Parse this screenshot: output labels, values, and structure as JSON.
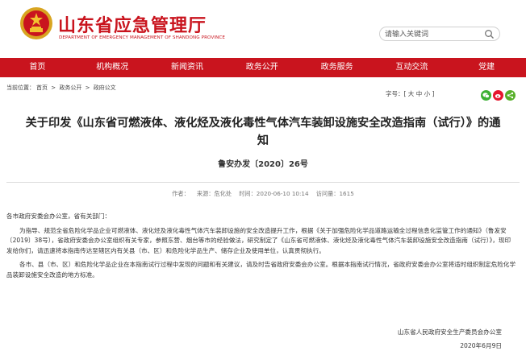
{
  "header": {
    "site_title": "山东省应急管理厅",
    "site_subtitle": "DEPARTMENT OF EMERGENCY MANAGEMENT OF SHANDONG PROVINCE",
    "search_placeholder": "请输入关键词"
  },
  "nav": {
    "items": [
      "首页",
      "机构概况",
      "新闻资讯",
      "政务公开",
      "政务服务",
      "互动交流",
      "党建"
    ]
  },
  "breadcrumb": {
    "prefix": "当前位置：",
    "items": [
      "首页",
      "政务公开",
      "政府公文"
    ],
    "separator": ">"
  },
  "font_size": {
    "label": "字号：",
    "options": "[ 大 中 小 ]"
  },
  "article": {
    "title": "关于印发《山东省可燃液体、液化烃及液化毒性气体汽车装卸设施安全改造指南（试行）》的通知",
    "doc_number": "鲁安办发〔2020〕26号",
    "author_label": "作者：",
    "author": "",
    "source_label": "来源：",
    "source": "危化处",
    "time_label": "时间：",
    "time": "2020-06-10 10:14",
    "views_label": "访问量：",
    "views": "1615",
    "salutation": "各市政府安委会办公室，省有关部门：",
    "paragraph1": "为指导、规范全省危险化学品企业可燃液体、液化烃及液化毒性气体汽车装卸设施的安全改造提升工作，根据《关于加强危险化学品道路运输全过程信息化监管工作的通知》（鲁发安〔2019〕38号），省政府安委会办公室组织有关专家，参照东营、烟台等市的经验做法，研究制定了《山东省可燃液体、液化烃及液化毒性气体汽车装卸设施安全改造指南（试行）》，现印发给你们，请迅速将本指南传达至辖区内有关县（市、区）和危险化学品生产、储存企业及使用单位，认真贯彻执行。",
    "paragraph2": "各市、县（市、区）和危险化学品企业在本指南试行过程中发现的问题和有关建议，请及时告省政府安委会办公室。根据本指南试行情况，省政府安委会办公室将适时组织制定危险化学品装卸设施安全改造的地方标准。",
    "signature_org": "山东省人民政府安全生产委员会办公室",
    "signature_date": "2020年6月9日"
  },
  "colors": {
    "brand_red": "#c9141e",
    "wechat_green": "#3cb034",
    "weibo_red": "#e6162d"
  },
  "icons": [
    "national-emblem-icon",
    "search-icon",
    "wechat-icon",
    "weibo-icon",
    "share-icon"
  ]
}
